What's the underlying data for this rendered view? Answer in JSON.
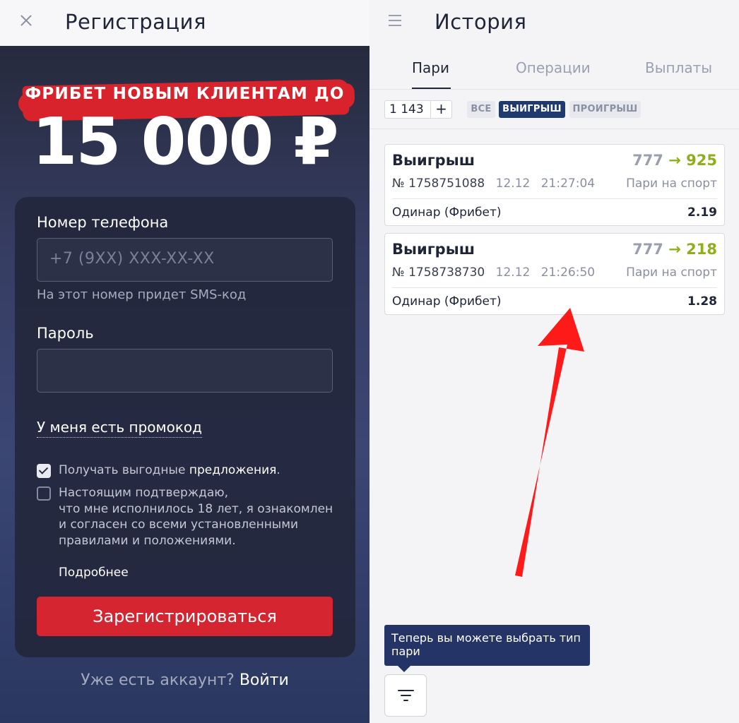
{
  "left": {
    "title": "Регистрация",
    "promo": {
      "line1": "ФРИБЕТ НОВЫМ КЛИЕНТАМ ДО",
      "amount": "15 000 ₽"
    },
    "form": {
      "phone_label": "Номер телефона",
      "phone_placeholder": "+7 (9XX) XXX-XX-XX",
      "phone_hint": "На этот номер придет SMS-код",
      "password_label": "Пароль",
      "password_value": "",
      "promo_link": "У меня есть промокод",
      "offers_checkbox": {
        "checked": true,
        "text_prefix": "Получать выгодные ",
        "text_highlight": "предложения",
        "text_suffix": "."
      },
      "age_checkbox": {
        "checked": false,
        "lines": [
          "Настоящим подтверждаю,",
          "что мне исполнилось 18 лет, я ознакомлен",
          "и согласен со всеми установленными",
          "правилами и положениями."
        ]
      },
      "more_link": "Подробнее",
      "register_button": "Зарегистрироваться"
    },
    "login_prompt": "Уже есть аккаунт?",
    "login_link": "Войти"
  },
  "right": {
    "title": "История",
    "tabs": [
      {
        "label": "Пари",
        "active": true
      },
      {
        "label": "Операции",
        "active": false
      },
      {
        "label": "Выплаты",
        "active": false
      }
    ],
    "counter": {
      "value": "1 143",
      "plus": "+"
    },
    "filters": [
      {
        "label": "ВСЕ",
        "selected": false
      },
      {
        "label": "ВЫИГРЫШ",
        "selected": true
      },
      {
        "label": "ПРОИГРЫШ",
        "selected": false
      }
    ],
    "bets": [
      {
        "status": "Выигрыш",
        "stake": "777",
        "arrow": "→",
        "payout": "925",
        "number": "№ 1758751088",
        "date": "12.12",
        "time": "21:27:04",
        "type": "Пари на спорт",
        "kind": "Одинар (Фрибет)",
        "coef": "2.19"
      },
      {
        "status": "Выигрыш",
        "stake": "777",
        "arrow": "→",
        "payout": "218",
        "number": "№ 1758738730",
        "date": "12.12",
        "time": "21:26:50",
        "type": "Пари на спорт",
        "kind": "Одинар (Фрибет)",
        "coef": "1.28"
      }
    ],
    "tooltip": "Теперь вы можете выбрать тип пари",
    "icons": {
      "close": "close-icon",
      "menu": "hamburger-menu-icon",
      "filter": "filter-icon"
    },
    "colors": {
      "accent_red": "#d42530",
      "win_green": "#8fae1b",
      "navy": "#1f3a6e",
      "annotation_arrow": "#ff1a1a"
    }
  }
}
